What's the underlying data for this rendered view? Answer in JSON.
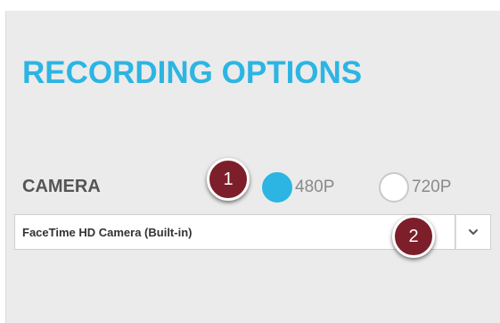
{
  "section": {
    "title": "RECORDING OPTIONS"
  },
  "camera": {
    "label": "CAMERA",
    "resolution_options": [
      {
        "label": "480P",
        "selected": true
      },
      {
        "label": "720P",
        "selected": false
      }
    ],
    "device_select": {
      "value": "FaceTime HD Camera (Built-in)"
    }
  },
  "annotations": {
    "badge_1": "1",
    "badge_2": "2"
  },
  "colors": {
    "accent": "#2cb5e3",
    "badge": "#7d1f2a",
    "panel_background": "#ebebeb",
    "label_text": "#555555"
  },
  "icons": {
    "dropdown": "chevron-down-icon"
  }
}
